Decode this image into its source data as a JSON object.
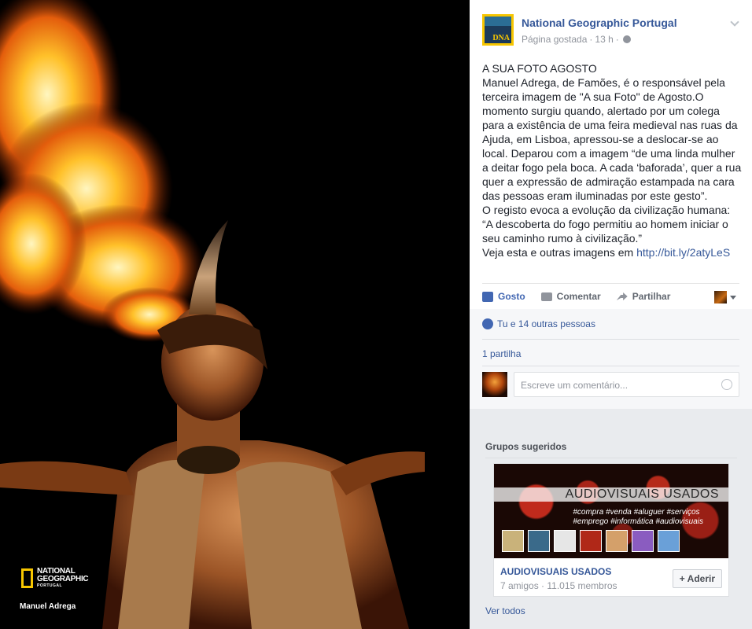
{
  "photo": {
    "logo_line1": "NATIONAL",
    "logo_line2": "GEOGRAPHIC",
    "logo_line3": "PORTUGAL",
    "credit": "Manuel Adrega"
  },
  "post": {
    "page_name": "National Geographic Portugal",
    "meta_liked": "Página gostada",
    "meta_sep1": "·",
    "meta_time": "13 h",
    "meta_sep2": "·",
    "avatar_text": "DNA",
    "body_text": "A SUA FOTO AGOSTO\nManuel Adrega, de Famões, é o responsável pela terceira imagem de \"A sua Foto\" de Agosto.O momento surgiu quando, alertado por um colega para a existência de uma feira medieval nas ruas da Ajuda, em Lisboa, apressou-se a deslocar-se ao local. Deparou com a imagem “de uma linda mulher a deitar fogo pela boca. A cada ‘baforada’, quer a rua quer a expressão de admiração estampada na cara das pessoas eram iluminadas por este gesto”.\nO registo evoca a evolução da civilização humana: “A descoberta do fogo permitiu ao homem iniciar o seu caminho rumo à civilização.”\nVeja esta e outras imagens em ",
    "link": "http://bit.ly/2atyLeS"
  },
  "actions": {
    "like": "Gosto",
    "comment": "Comentar",
    "share": "Partilhar"
  },
  "feedback": {
    "likes": "Tu e 14 outras pessoas",
    "shares": "1 partilha",
    "comment_placeholder": "Escreve um comentário..."
  },
  "groups": {
    "title": "Grupos sugeridos",
    "banner_title": "AUDIOVISUAIS USADOS",
    "banner_tags_1": "#compra #venda #aluguer #serviços",
    "banner_tags_2": "#emprego #informática #audiovisuais",
    "group_name": "AUDIOVISUAIS USADOS",
    "group_meta": "7 amigos · 11.015 membros",
    "join_label": "+ Aderir",
    "see_all": "Ver todos"
  },
  "colors": {
    "link": "#365899",
    "like_blue": "#4267b2",
    "ng_yellow": "#f7c600"
  }
}
